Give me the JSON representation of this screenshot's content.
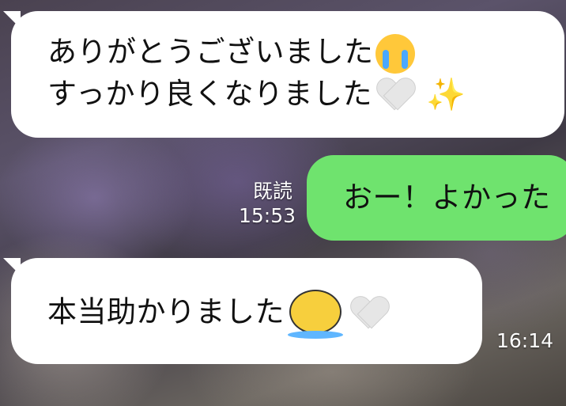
{
  "messages": [
    {
      "direction": "incoming",
      "lines": [
        "ありがとうございました",
        "すっかり良くなりました"
      ],
      "emoji": [
        "loudly-crying-face",
        "white-heart",
        "sparkles"
      ]
    },
    {
      "direction": "outgoing",
      "text": "おー！よかった",
      "read_label": "既読",
      "time": "15:53"
    },
    {
      "direction": "incoming",
      "text": "本当助かりました",
      "emoji": [
        "crying-sticker",
        "white-heart"
      ],
      "time": "16:14"
    }
  ],
  "colors": {
    "incoming_bubble": "#ffffff",
    "outgoing_bubble": "#6fe36e",
    "meta_text": "#ffffff"
  }
}
